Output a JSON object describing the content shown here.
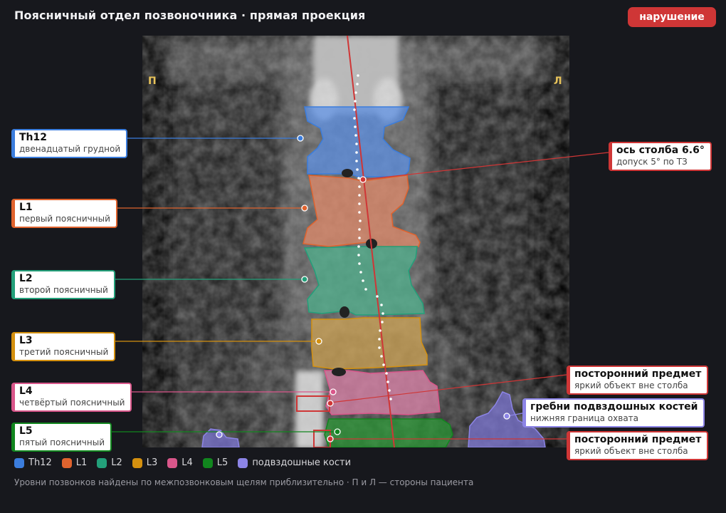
{
  "header": {
    "title": "Поясничный отдел позвоночника · прямая проекция",
    "status_badge": "нарушение"
  },
  "image": {
    "side_right_patient": "П",
    "side_left_patient": "Л"
  },
  "vertebrae": [
    {
      "code": "Th12",
      "desc": "двенадцатый грудной",
      "color": "#3b7ddd"
    },
    {
      "code": "L1",
      "desc": "первый поясничный",
      "color": "#e0632e"
    },
    {
      "code": "L2",
      "desc": "второй поясничный",
      "color": "#23a07a"
    },
    {
      "code": "L3",
      "desc": "третий поясничный",
      "color": "#d4900f"
    },
    {
      "code": "L4",
      "desc": "четвёртый поясничный",
      "color": "#d9568a"
    },
    {
      "code": "L5",
      "desc": "пятый поясничный",
      "color": "#11861e"
    }
  ],
  "annotations": {
    "axis": {
      "title": "ось столба 6.6°",
      "note": "допуск 5° по ТЗ",
      "color": "#cf3636"
    },
    "foreign_1": {
      "title": "посторонний предмет",
      "note": "яркий объект вне столба",
      "color": "#cf3636"
    },
    "iliac": {
      "title": "гребни подвздошных костей",
      "note": "нижняя граница охвата",
      "color": "#8c84e6"
    },
    "foreign_2": {
      "title": "посторонний предмет",
      "note": "яркий объект вне столба",
      "color": "#cf3636"
    }
  },
  "legend": [
    {
      "label": "Th12",
      "color": "#3b7ddd"
    },
    {
      "label": "L1",
      "color": "#e0632e"
    },
    {
      "label": "L2",
      "color": "#23a07a"
    },
    {
      "label": "L3",
      "color": "#d4900f"
    },
    {
      "label": "L4",
      "color": "#d9568a"
    },
    {
      "label": "L5",
      "color": "#11861e"
    },
    {
      "label": "подвздошные кости",
      "color": "#8c84e6"
    }
  ],
  "footer": "Уровни позвонков найдены по межпозвонковым щелям приблизительно · П и Л — стороны пациента"
}
